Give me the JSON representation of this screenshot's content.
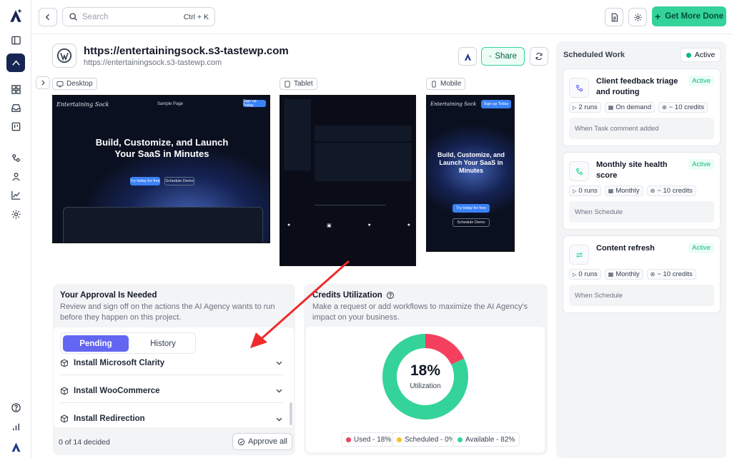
{
  "topbar": {
    "search_placeholder": "Search",
    "search_shortcut": "Ctrl + K",
    "cta_label": "Get More Done"
  },
  "site": {
    "title": "https://entertainingsock.s3-tastewp.com",
    "subtitle": "https://entertainingsock.s3-tastewp.com",
    "share_label": "Share"
  },
  "previews": {
    "desktop_label": "Desktop",
    "tablet_label": "Tablet",
    "mobile_label": "Mobile",
    "brand": "Entertaining Sock",
    "nav": "Sample Page",
    "signup": "Sign up Today",
    "headline": "Build, Customize, and Launch Your SaaS in Minutes",
    "cta_try": "Try today for free",
    "cta_demo": "Schedule Demo"
  },
  "approval": {
    "title": "Your Approval Is Needed",
    "desc": "Review and sign off on the actions the AI Agency wants to run before they happen on this project.",
    "tab_pending": "Pending",
    "tab_history": "History",
    "items": [
      {
        "label": "Install Microsoft Clarity"
      },
      {
        "label": "Install WooCommerce"
      },
      {
        "label": "Install Redirection"
      }
    ],
    "decided": "0 of 14 decided",
    "approve_all": "Approve all"
  },
  "credits": {
    "title": "Credits Utilization",
    "desc": "Make a request or add workflows to maximize the AI Agency's impact on your business.",
    "percent_label": "18%",
    "center_label": "Utilization",
    "colors": {
      "used": "#f43f5e",
      "scheduled": "#fbbf24",
      "available": "#34d399"
    },
    "chart_data": {
      "type": "pie",
      "categories": [
        "Used",
        "Scheduled",
        "Available"
      ],
      "values": [
        18,
        0,
        82
      ]
    },
    "legend": [
      {
        "label": "Used - 18%",
        "color": "#f43f5e"
      },
      {
        "label": "Scheduled - 0%",
        "color": "#fbbf24"
      },
      {
        "label": "Available - 82%",
        "color": "#34d399"
      }
    ]
  },
  "scheduled": {
    "title": "Scheduled Work",
    "status": "Active",
    "items": [
      {
        "name": "Client feedback triage and routing",
        "status": "Active",
        "runs": "2 runs",
        "freq": "On demand",
        "credits": "~ 10 credits",
        "trigger": "When Task comment added",
        "icon": "workflow-icon"
      },
      {
        "name": "Monthly site health score",
        "status": "Active",
        "runs": "0 runs",
        "freq": "Monthly",
        "credits": "~ 10 credits",
        "trigger": "When Schedule",
        "icon": "workflow-icon"
      },
      {
        "name": "Content refresh",
        "status": "Active",
        "runs": "0 runs",
        "freq": "Monthly",
        "credits": "~ 10 credits",
        "trigger": "When Schedule",
        "icon": "refresh-icon"
      }
    ]
  }
}
